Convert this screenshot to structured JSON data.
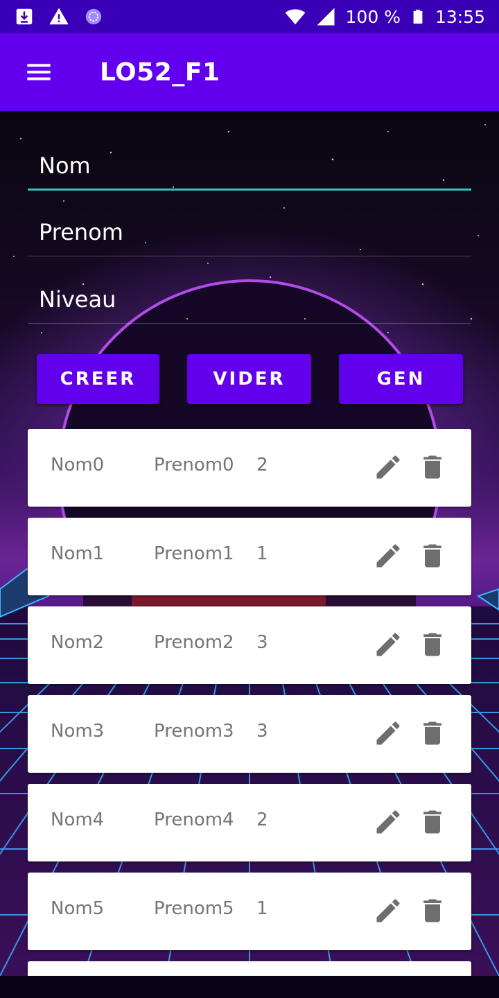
{
  "status_bar": {
    "battery": "100 %",
    "time": "13:55",
    "icons": [
      "download-icon",
      "warning-icon",
      "sync-icon",
      "wifi-icon",
      "signal-icon",
      "battery-icon"
    ]
  },
  "app_bar": {
    "title": "LO52_F1",
    "menu_icon": "menu-icon",
    "color": "#6200ee"
  },
  "form": {
    "nom_placeholder": "Nom",
    "prenom_placeholder": "Prenom",
    "niveau_placeholder": "Niveau",
    "focus_color": "#36c2c2"
  },
  "buttons": {
    "creer": "CREER",
    "vider": "VIDER",
    "gen": "GEN"
  },
  "list": {
    "row_actions": [
      "edit-icon",
      "delete-icon"
    ],
    "rows": [
      {
        "nom": "Nom0",
        "prenom": "Prenom0",
        "niveau": "2"
      },
      {
        "nom": "Nom1",
        "prenom": "Prenom1",
        "niveau": "1"
      },
      {
        "nom": "Nom2",
        "prenom": "Prenom2",
        "niveau": "3"
      },
      {
        "nom": "Nom3",
        "prenom": "Prenom3",
        "niveau": "3"
      },
      {
        "nom": "Nom4",
        "prenom": "Prenom4",
        "niveau": "2"
      },
      {
        "nom": "Nom5",
        "prenom": "Prenom5",
        "niveau": "1"
      },
      {
        "nom": "",
        "prenom": "",
        "niveau": ""
      }
    ]
  }
}
